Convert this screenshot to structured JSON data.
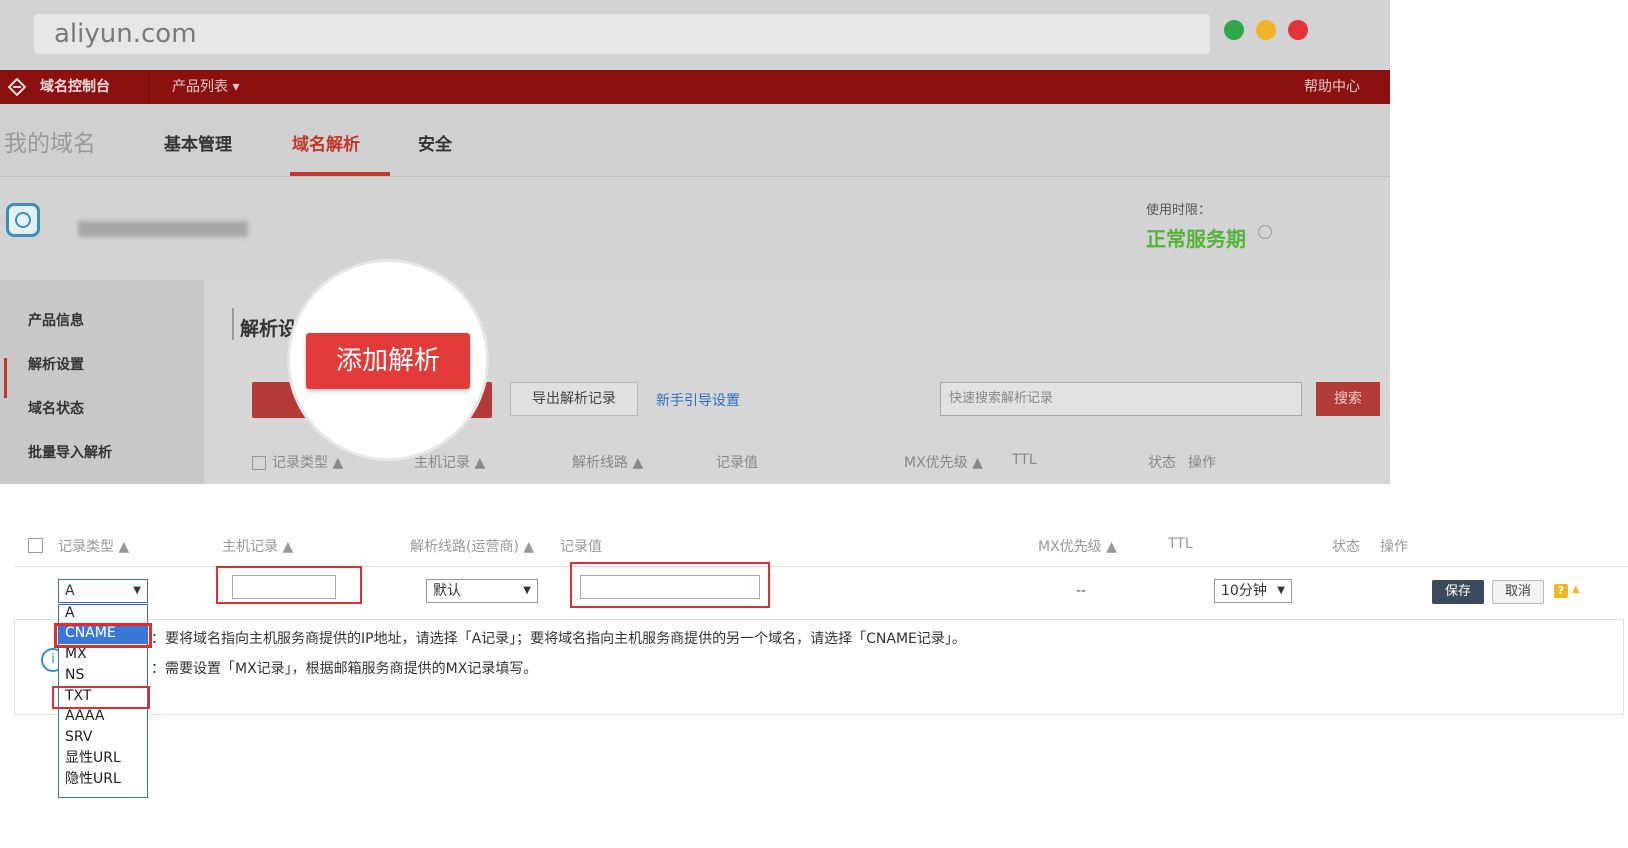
{
  "browser": {
    "url": "aliyun.com"
  },
  "window_dots": {
    "green": "#2ea84a",
    "yellow": "#f0b429",
    "red": "#e2353b"
  },
  "topnav": {
    "brand": "域名控制台",
    "products": "产品列表 ▾",
    "help": "帮助中心"
  },
  "tabs": {
    "my_domains": "我的域名",
    "basic": "基本管理",
    "dns": "域名解析",
    "security": "安全"
  },
  "service": {
    "label": "使用时限：",
    "status": "正常服务期"
  },
  "sidebar": {
    "items": [
      "产品信息",
      "解析设置",
      "域名状态",
      "批量导入解析"
    ]
  },
  "main": {
    "section_title": "解析设置",
    "add_button": "添加解析",
    "export_button": "导出解析记录",
    "guide_link": "新手引导设置",
    "search_placeholder": "快速搜索解析记录",
    "search_button": "搜索",
    "bg_headers": [
      "记录类型 ▲",
      "主机记录 ▲",
      "解析线路 ▲",
      "记录值",
      "MX优先级 ▲",
      "TTL",
      "状态",
      "操作"
    ]
  },
  "table": {
    "headers": {
      "type": "记录类型 ▲",
      "host": "主机记录 ▲",
      "line": "解析线路(运营商) ▲",
      "value": "记录值",
      "mx": "MX优先级 ▲",
      "ttl": "TTL",
      "status": "状态",
      "action": "操作"
    },
    "row": {
      "type_selected": "A",
      "line_selected": "默认",
      "mx_value": "--",
      "ttl_selected": "10分钟",
      "save": "保存",
      "cancel": "取消",
      "help_icon": "?"
    },
    "type_options": [
      "A",
      "CNAME",
      "MX",
      "NS",
      "TXT",
      "AAAA",
      "SRV",
      "显性URL",
      "隐性URL"
    ],
    "highlighted_option": "CNAME",
    "notes": [
      "：要将域名指向主机服务商提供的IP地址，请选择「A记录」；要将域名指向主机服务商提供的另一个域名，请选择「CNAME记录」。",
      "：需要设置「MX记录」，根据邮箱服务商提供的MX记录填写。"
    ],
    "info_icon": "i"
  },
  "colors": {
    "brand_red": "#8b1111",
    "accent_red": "#e33b39",
    "highlight_blue": "#3a78d8",
    "green": "#55b33a"
  }
}
